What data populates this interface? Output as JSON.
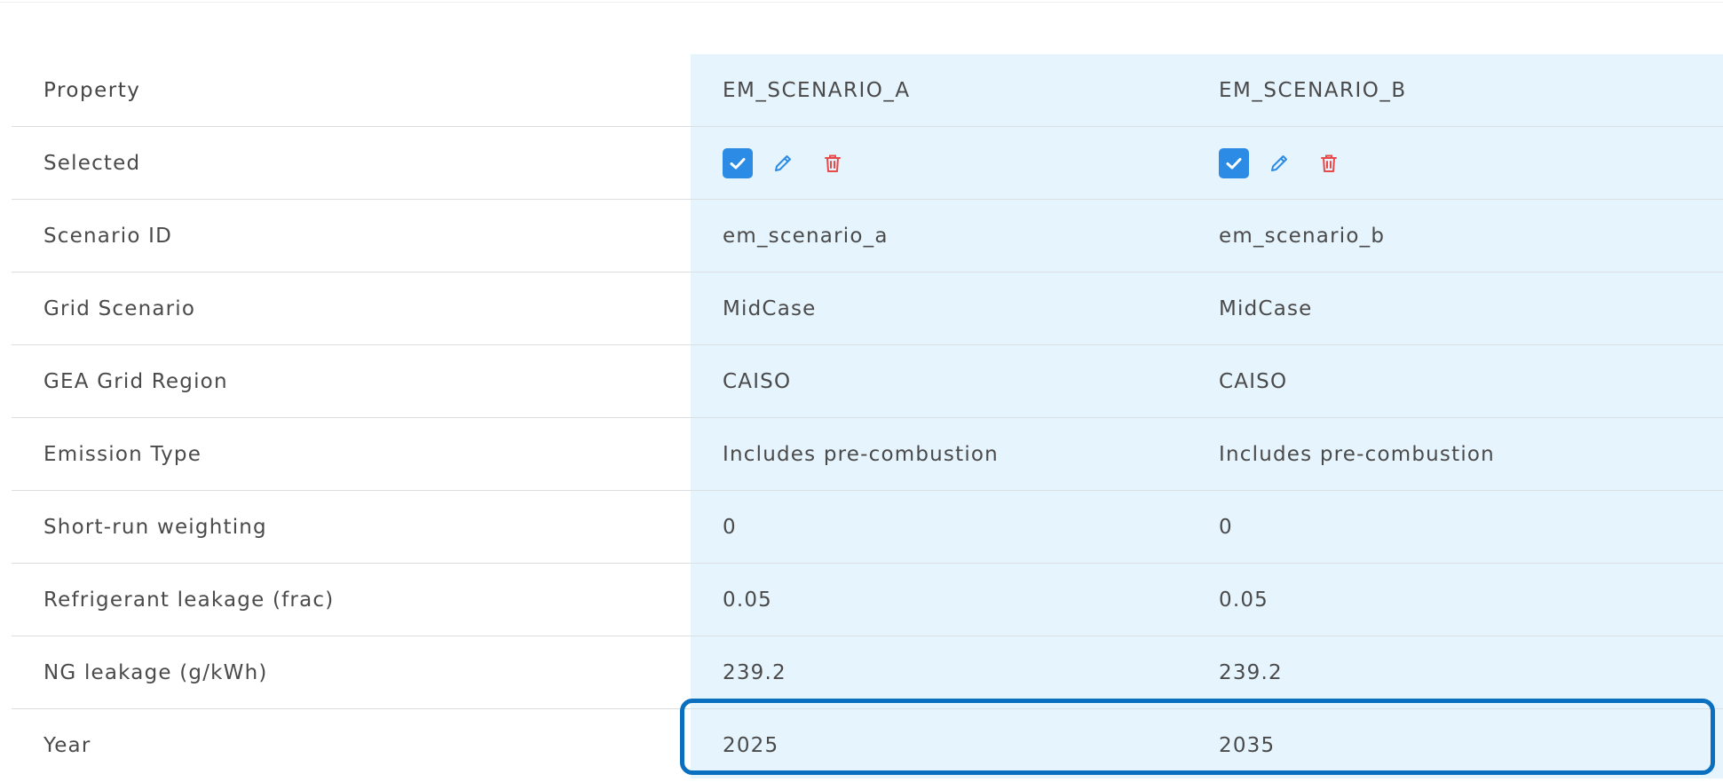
{
  "table": {
    "header": {
      "property": "Property",
      "scenario_a": "EM_SCENARIO_A",
      "scenario_b": "EM_SCENARIO_B"
    },
    "selected_label": "Selected",
    "rows": [
      {
        "label": "Scenario ID",
        "a": "em_scenario_a",
        "b": "em_scenario_b"
      },
      {
        "label": "Grid Scenario",
        "a": "MidCase",
        "b": "MidCase"
      },
      {
        "label": "GEA Grid Region",
        "a": "CAISO",
        "b": "CAISO"
      },
      {
        "label": "Emission Type",
        "a": "Includes pre-combustion",
        "b": "Includes pre-combustion"
      },
      {
        "label": "Short-run weighting",
        "a": "0",
        "b": "0"
      },
      {
        "label": "Refrigerant leakage (frac)",
        "a": "0.05",
        "b": "0.05"
      },
      {
        "label": "NG leakage (g/kWh)",
        "a": "239.2",
        "b": "239.2"
      },
      {
        "label": "Year",
        "a": "2025",
        "b": "2035"
      }
    ]
  },
  "colors": {
    "checkbox": "#2b8be5",
    "edit_icon": "#2b8be5",
    "delete_icon": "#e84a4a",
    "column_background": "#e6f4fd",
    "highlight_border": "#0a6fbf"
  },
  "icons": {
    "checkbox": "check-icon",
    "edit": "pencil-icon",
    "delete": "trash-icon"
  }
}
